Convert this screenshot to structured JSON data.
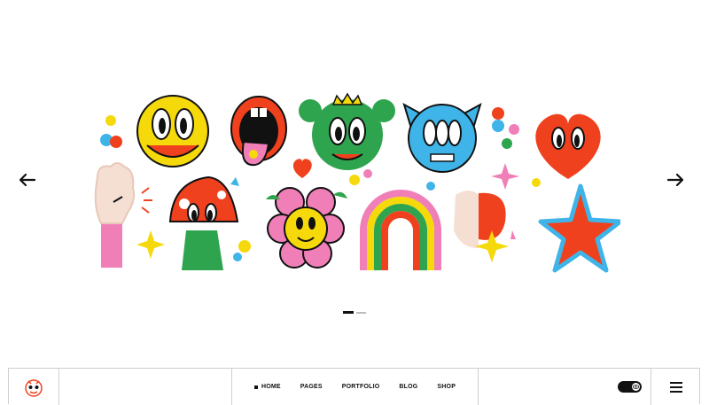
{
  "slider": {
    "prev_icon": "arrow-left-icon",
    "next_icon": "arrow-right-icon",
    "slide_count": 2,
    "active_slide": 1
  },
  "navbar": {
    "logo_icon": "cartoon-face-logo-icon",
    "items": [
      {
        "label": "HOME",
        "active": true
      },
      {
        "label": "PAGES",
        "active": false
      },
      {
        "label": "PORTFOLIO",
        "active": false
      },
      {
        "label": "BLOG",
        "active": false
      },
      {
        "label": "SHOP",
        "active": false
      }
    ],
    "theme_toggle_icon": "eye-icon",
    "menu_icon": "hamburger-menu-icon"
  },
  "colors": {
    "yellow": "#f5d90a",
    "red": "#f0411e",
    "green": "#2fa44f",
    "blue": "#3fb4e8",
    "pink": "#f07fb8",
    "dark": "#111111"
  }
}
